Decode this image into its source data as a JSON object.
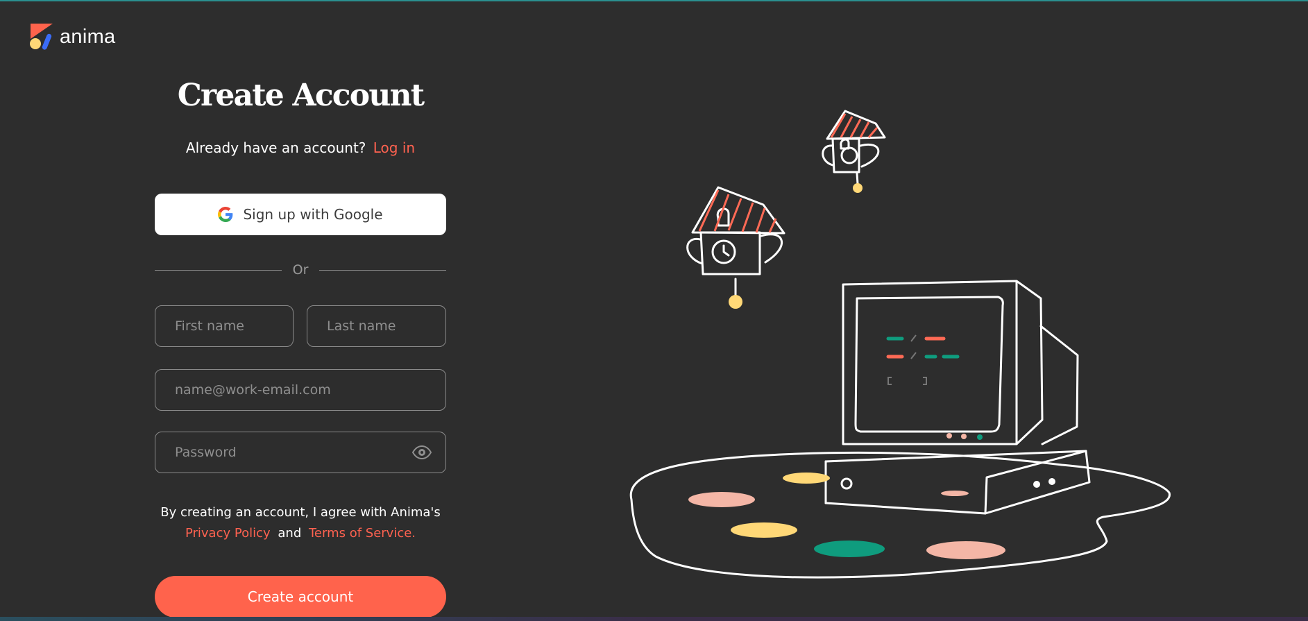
{
  "brand": {
    "name": "anima"
  },
  "form": {
    "title": "Create Account",
    "login_prompt": "Already have an account?",
    "login_link": "Log in",
    "google_button": "Sign up with Google",
    "divider": "Or",
    "first_name_placeholder": "First name",
    "last_name_placeholder": "Last name",
    "email_placeholder": "name@work-email.com",
    "password_placeholder": "Password",
    "terms_prefix": "By creating an account, I agree with Anima's",
    "privacy_link": "Privacy Policy",
    "terms_and": "and",
    "terms_link": "Terms of Service.",
    "submit": "Create account"
  },
  "colors": {
    "background": "#2d2d2d",
    "accent": "#ff634c",
    "link": "#ff6250",
    "yellow": "#ffd877",
    "pink": "#f4b6a6",
    "teal": "#0f9c7e"
  },
  "icons": [
    "anima-logo-icon",
    "google-icon",
    "eye-icon"
  ]
}
